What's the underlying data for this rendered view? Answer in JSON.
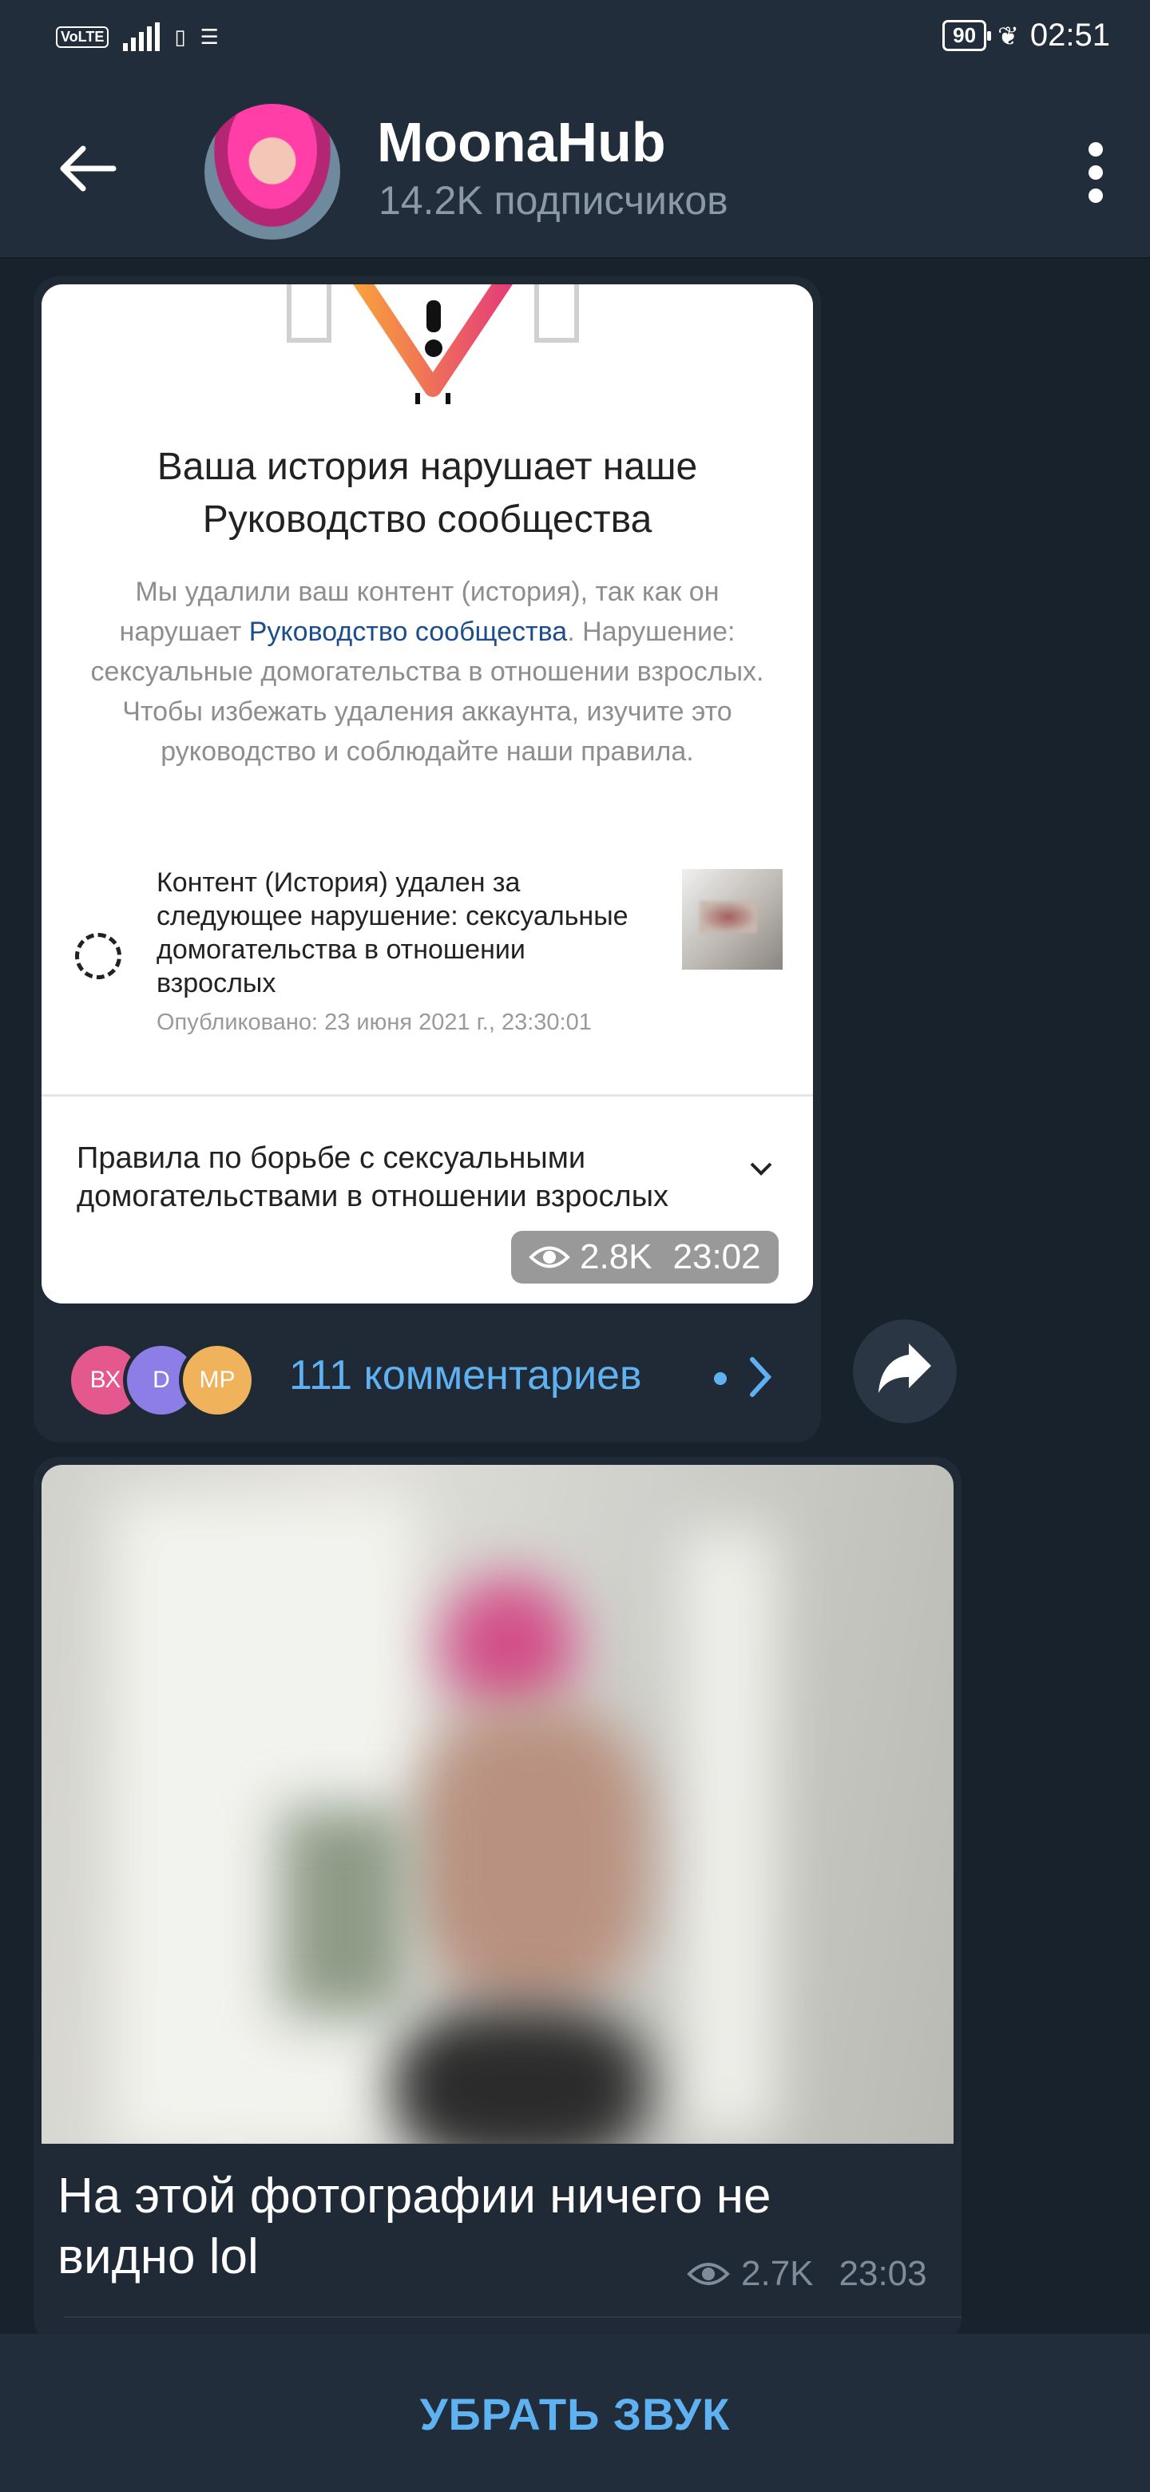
{
  "status_bar": {
    "left_indicators": "VoLTE 4G+",
    "battery": "90",
    "time": "02:51"
  },
  "header": {
    "title": "MoonaHub",
    "subtitle": "14.2K подписчиков"
  },
  "message1": {
    "heading": "Ваша история нарушает наше Руководство сообщества",
    "text_before_link": "Мы удалили ваш контент (история), так как он нарушает ",
    "link_text": "Руководство сообщества",
    "text_after_link": ". Нарушение: сексуальные домогательства в отношении взрослых. Чтобы избежать удаления аккаунта, изучите это руководство и соблюдайте наши правила.",
    "violation_text": "Контент (История) удален за следующее нарушение: сексуальные домогательства в отношении взрослых",
    "published": "Опубликовано: 23 июня 2021 г., 23:30:01",
    "rules_row": "Правила по борьбе с сексуальными домогательствами в отношении взрослых",
    "views": "2.8K",
    "time": "23:02",
    "commenter_avatars": [
      {
        "initials": "ВХ",
        "color": "#e5588e"
      },
      {
        "initials": "D",
        "color": "#8c7ee6"
      },
      {
        "initials": "МР",
        "color": "#f0b35b"
      }
    ],
    "comments_label": "111 комментариев"
  },
  "message2": {
    "caption": "На этой фотографии ничего не видно lol",
    "views": "2.7K",
    "time": "23:03"
  },
  "bottom_bar": {
    "mute_label": "УБРАТЬ ЗВУК"
  },
  "colors": {
    "accent": "#5fb2f1",
    "background": "#18222d",
    "header": "#212d3b",
    "bubble": "#1f2a36"
  }
}
